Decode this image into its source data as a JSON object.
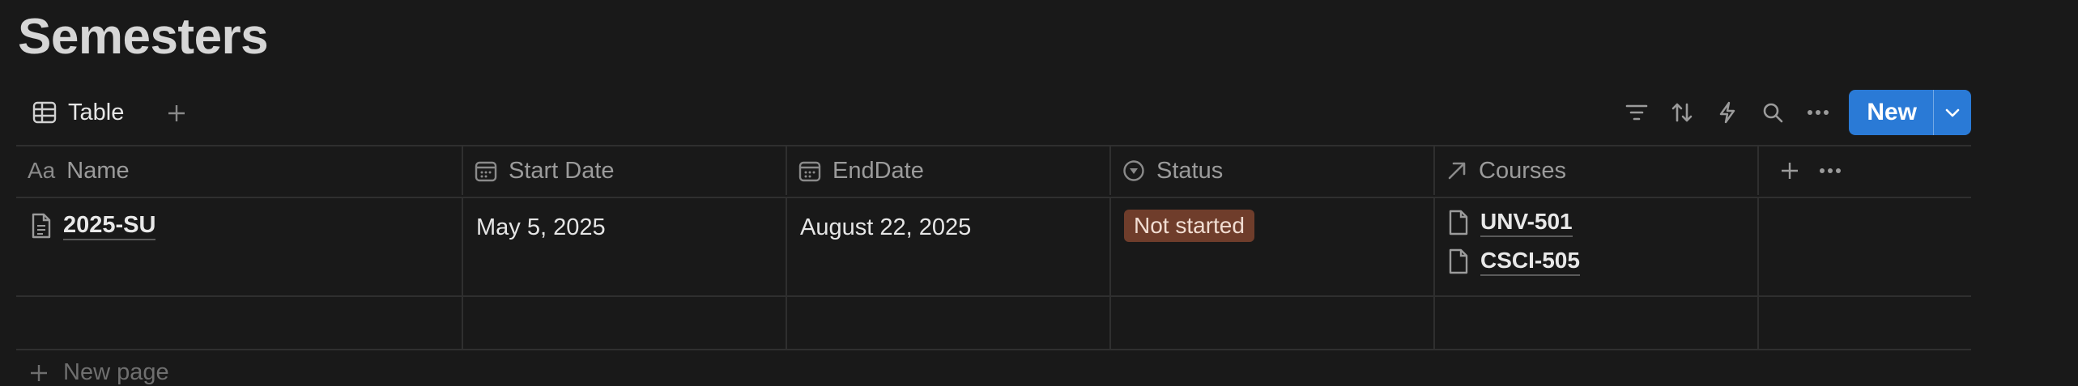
{
  "page": {
    "title": "Semesters"
  },
  "view": {
    "tab_label": "Table",
    "new_label": "New"
  },
  "columns": [
    {
      "label": "Name",
      "icon": "text-type-icon"
    },
    {
      "label": "Start Date",
      "icon": "calendar-icon"
    },
    {
      "label": "EndDate",
      "icon": "calendar-icon"
    },
    {
      "label": "Status",
      "icon": "status-icon"
    },
    {
      "label": "Courses",
      "icon": "relation-arrow-icon"
    }
  ],
  "rows": [
    {
      "name": "2025-SU",
      "start_date": "May 5, 2025",
      "end_date": "August 22, 2025",
      "status": "Not started",
      "courses": [
        "UNV-501",
        "CSCI-505"
      ]
    }
  ],
  "footer": {
    "new_page_label": "New page"
  },
  "colors": {
    "accent": "#2a7ad6",
    "status_not_started_bg": "#6f3d2b",
    "background": "#191919"
  }
}
